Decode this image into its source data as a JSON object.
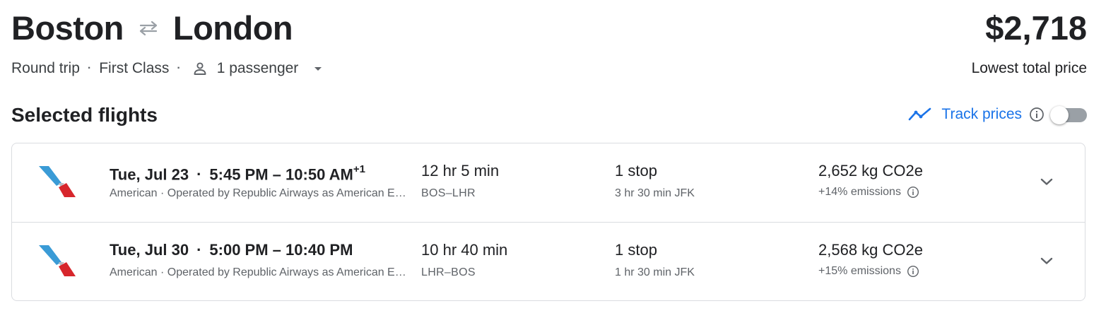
{
  "header": {
    "origin": "Boston",
    "destination": "London",
    "price": "$2,718",
    "price_label": "Lowest total price"
  },
  "search": {
    "trip_type": "Round trip",
    "cabin_class": "First Class",
    "passengers": "1 passenger"
  },
  "section": {
    "title": "Selected flights",
    "track_label": "Track prices",
    "track_enabled": false
  },
  "flights": [
    {
      "date": "Tue, Jul 23",
      "depart": "5:45 PM",
      "arrive": "10:50 AM",
      "day_offset": "+1",
      "airline": "American · Operated by Republic Airways as American Eagle",
      "duration": "12 hr 5 min",
      "route": "BOS–LHR",
      "stops": "1 stop",
      "layover": "3 hr 30 min JFK",
      "co2": "2,652 kg CO2e",
      "emissions": "+14% emissions"
    },
    {
      "date": "Tue, Jul 30",
      "depart": "5:00 PM",
      "arrive": "10:40 PM",
      "day_offset": "",
      "airline": "American · Operated by Republic Airways as American Eagle",
      "duration": "10 hr 40 min",
      "route": "LHR–BOS",
      "stops": "1 stop",
      "layover": "1 hr 30 min JFK",
      "co2": "2,568 kg CO2e",
      "emissions": "+15% emissions"
    }
  ],
  "colors": {
    "accent": "#1a73e8",
    "text": "#202124",
    "muted": "#5f6368",
    "border": "#dadce0"
  },
  "icons": [
    "swap-arrows-icon",
    "person-icon",
    "caret-down-icon",
    "trend-line-icon",
    "info-icon",
    "airline-logo",
    "chevron-down-icon"
  ]
}
